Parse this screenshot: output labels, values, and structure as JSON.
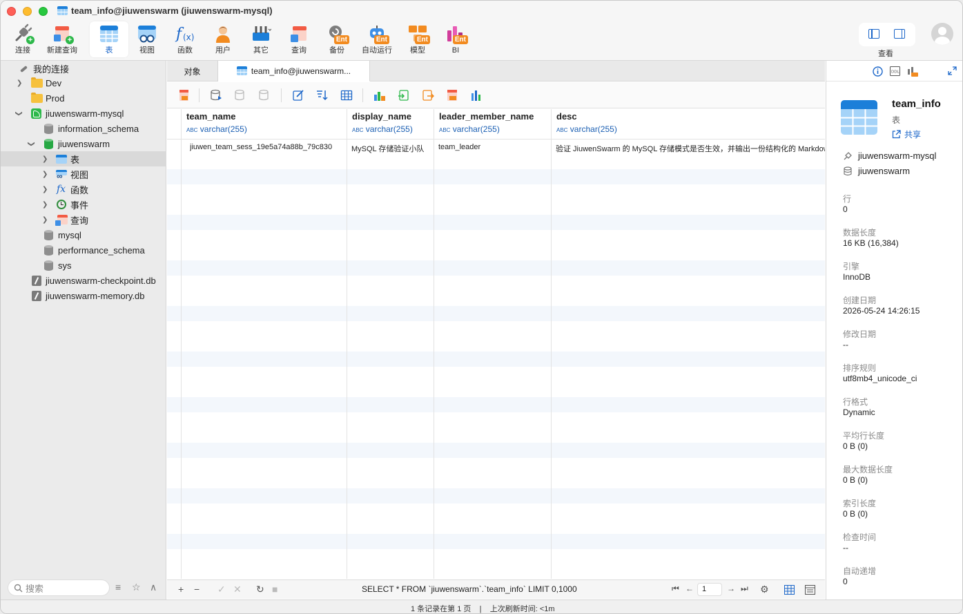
{
  "window": {
    "title": "team_info@jiuwenswarm (jiuwenswarm-mysql)"
  },
  "toolbar": {
    "items": [
      {
        "label": "连接",
        "icon": "connection-plug-icon"
      },
      {
        "label": "新建查询",
        "icon": "new-query-icon"
      },
      {
        "label": "表",
        "icon": "table-icon"
      },
      {
        "label": "视图",
        "icon": "view-icon"
      },
      {
        "label": "函数",
        "icon": "function-icon"
      },
      {
        "label": "用户",
        "icon": "user-icon"
      },
      {
        "label": "其它",
        "icon": "other-tools-icon"
      },
      {
        "label": "查询",
        "icon": "query-icon"
      },
      {
        "label": "备份",
        "icon": "backup-icon"
      },
      {
        "label": "自动运行",
        "icon": "automation-icon"
      },
      {
        "label": "模型",
        "icon": "model-icon"
      },
      {
        "label": "BI",
        "icon": "bi-icon"
      }
    ],
    "ent_badge": "Ent",
    "view_label": "查看"
  },
  "sidebar": {
    "root_label": "我的连接",
    "items": [
      {
        "label": "Dev"
      },
      {
        "label": "Prod"
      },
      {
        "label": "jiuwenswarm-mysql"
      },
      {
        "label": "information_schema"
      },
      {
        "label": "jiuwenswarm"
      },
      {
        "label": "表"
      },
      {
        "label": "视图"
      },
      {
        "label": "函数"
      },
      {
        "label": "事件"
      },
      {
        "label": "查询"
      },
      {
        "label": "mysql"
      },
      {
        "label": "performance_schema"
      },
      {
        "label": "sys"
      },
      {
        "label": "jiuwenswarm-checkpoint.db"
      },
      {
        "label": "jiuwenswarm-memory.db"
      }
    ],
    "search_placeholder": "搜索"
  },
  "tabs": [
    {
      "label": "对象"
    },
    {
      "label": "team_info@jiuwenswarm..."
    }
  ],
  "grid": {
    "columns": [
      {
        "name": "team_name",
        "type": "varchar(255)"
      },
      {
        "name": "display_name",
        "type": "varchar(255)"
      },
      {
        "name": "leader_member_name",
        "type": "varchar(255)"
      },
      {
        "name": "desc",
        "type": "varchar(255)"
      }
    ],
    "rows": [
      [
        "jiuwen_team_sess_19e5a74a88b_79c830",
        "MySQL 存储验证小队",
        "team_leader",
        "验证 JiuwenSwarm 的 MySQL 存储模式是否生效，并输出一份结构化的 Markdown"
      ]
    ]
  },
  "bottom": {
    "sql": "SELECT * FROM `jiuwenswarm`.`team_info` LIMIT 0,1000",
    "page": "1"
  },
  "status": {
    "records": "1 条记录在第 1 页",
    "separator": "|",
    "refresh": "上次刷新时间: <1m"
  },
  "info": {
    "name": "team_info",
    "type": "表",
    "share": "共享",
    "connection": "jiuwenswarm-mysql",
    "database": "jiuwenswarm",
    "props": [
      {
        "label": "行",
        "value": "0"
      },
      {
        "label": "数据长度",
        "value": "16 KB (16,384)"
      },
      {
        "label": "引擎",
        "value": "InnoDB"
      },
      {
        "label": "创建日期",
        "value": "2026-05-24 14:26:15"
      },
      {
        "label": "修改日期",
        "value": "--"
      },
      {
        "label": "排序规则",
        "value": "utf8mb4_unicode_ci"
      },
      {
        "label": "行格式",
        "value": "Dynamic"
      },
      {
        "label": "平均行长度",
        "value": "0 B (0)"
      },
      {
        "label": "最大数据长度",
        "value": "0 B (0)"
      },
      {
        "label": "索引长度",
        "value": "0 B (0)"
      },
      {
        "label": "检查时间",
        "value": "--"
      },
      {
        "label": "自动递增",
        "value": "0"
      }
    ]
  },
  "colors": {
    "accent": "#1b66c9",
    "ent_badge": "#f28b20",
    "mysql_green": "#2db84a"
  }
}
